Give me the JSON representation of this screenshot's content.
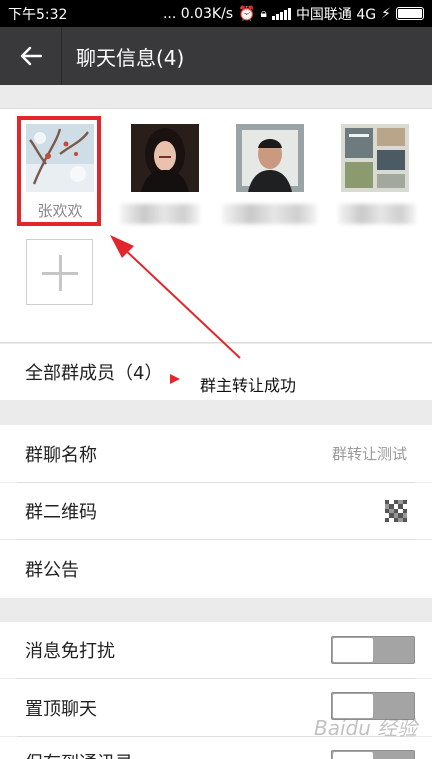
{
  "status_bar": {
    "time": "下午5:32",
    "network_speed": "... 0.03K/s",
    "carrier": "中国联通 4G"
  },
  "header": {
    "back_icon": "arrow-left-icon",
    "title": "聊天信息(4)"
  },
  "members": [
    {
      "name": "张欢欢",
      "avatar": "winter-tree-avatar"
    },
    {
      "name": "",
      "avatar": "woman-portrait-avatar"
    },
    {
      "name": "",
      "avatar": "man-portrait-avatar"
    },
    {
      "name": "",
      "avatar": "magazine-avatar"
    }
  ],
  "add_member_icon": "plus-icon",
  "all_members": {
    "label": "全部群成员（4）",
    "annotation": "群主转让成功"
  },
  "settings": {
    "group_name": {
      "label": "群聊名称",
      "value": "群转让测试"
    },
    "qr_code": {
      "label": "群二维码"
    },
    "announcement": {
      "label": "群公告"
    },
    "mute": {
      "label": "消息免打扰",
      "on": false
    },
    "pin": {
      "label": "置顶聊天",
      "on": false
    },
    "save": {
      "label": "保存到通讯录",
      "on": false
    }
  },
  "colors": {
    "highlight": "#e3262b",
    "title_bar": "#39393b",
    "toggle_off": "#a4a4a4"
  },
  "watermark": "Baidu 经验"
}
